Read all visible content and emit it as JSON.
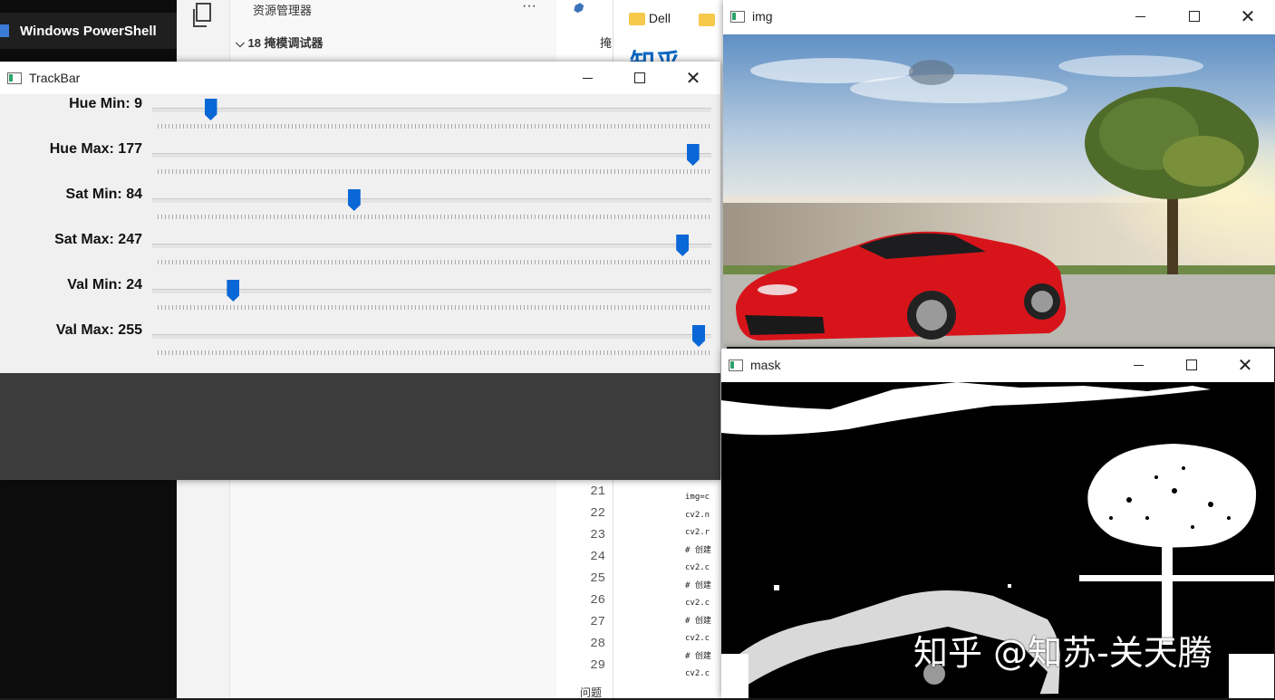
{
  "taskbar": {
    "powershell_title": "Windows PowerShell"
  },
  "vscode": {
    "explorer_title": "资源管理器",
    "explorer_more": "···",
    "folder_name": "18 掩模调试器",
    "line_numbers": [
      "21",
      "22",
      "23",
      "24",
      "25",
      "26",
      "27",
      "28",
      "29"
    ],
    "editor_tab_fragment": "掩",
    "status_problems": "问题"
  },
  "browser": {
    "bookmark_dell": "Dell",
    "zhihu_logo_fragment": "知乎",
    "code_lines": [
      "img=c",
      "cv2.n",
      "cv2.r",
      "# 创建",
      "cv2.c",
      "# 创建",
      "cv2.c",
      "# 创建",
      "cv2.c",
      "# 创建",
      "cv2.c"
    ]
  },
  "trackbar_window": {
    "title": "TrackBar",
    "trackbars": [
      {
        "label": "Hue Min: 9",
        "value": 9,
        "max": 179
      },
      {
        "label": "Hue Max: 177",
        "value": 177,
        "max": 179
      },
      {
        "label": "Sat Min: 84",
        "value": 84,
        "max": 255
      },
      {
        "label": "Sat Max: 247",
        "value": 247,
        "max": 255
      },
      {
        "label": "Val Min: 24",
        "value": 24,
        "max": 255
      },
      {
        "label": "Val Max: 255",
        "value": 255,
        "max": 255
      }
    ]
  },
  "img_window": {
    "title": "img"
  },
  "mask_window": {
    "title": "mask",
    "watermark": "知乎 @知苏-关天腾"
  },
  "colors": {
    "accent": "#0a67d6",
    "car_red": "#d8141b",
    "sky": "#6f9ccc"
  }
}
